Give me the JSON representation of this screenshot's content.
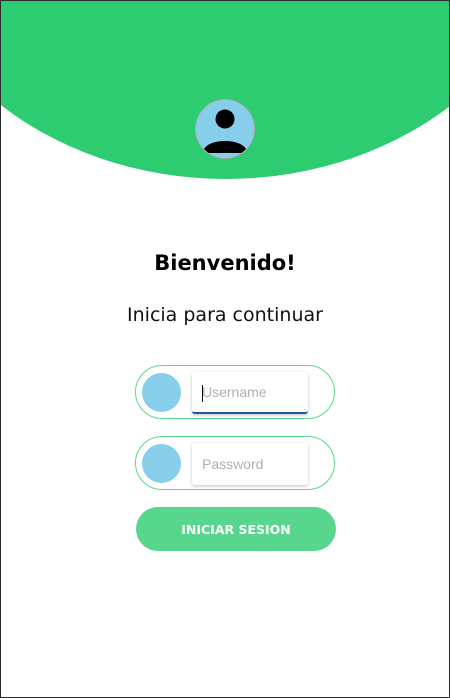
{
  "theme": {
    "header_color": "#2ecc71",
    "avatar_color": "#87ceeb",
    "button_color": "#58d68d",
    "field_border_color": "#59d98e"
  },
  "header": {
    "avatar_icon": "user-silhouette-icon"
  },
  "greeting": {
    "title": "Bienvenido!",
    "subtitle": "Inicia para continuar"
  },
  "form": {
    "username": {
      "icon": "user-icon",
      "placeholder": "Username",
      "value": ""
    },
    "password": {
      "icon": "lock-icon",
      "placeholder": "Password",
      "value": ""
    },
    "submit_label": "INICIAR SESION"
  }
}
